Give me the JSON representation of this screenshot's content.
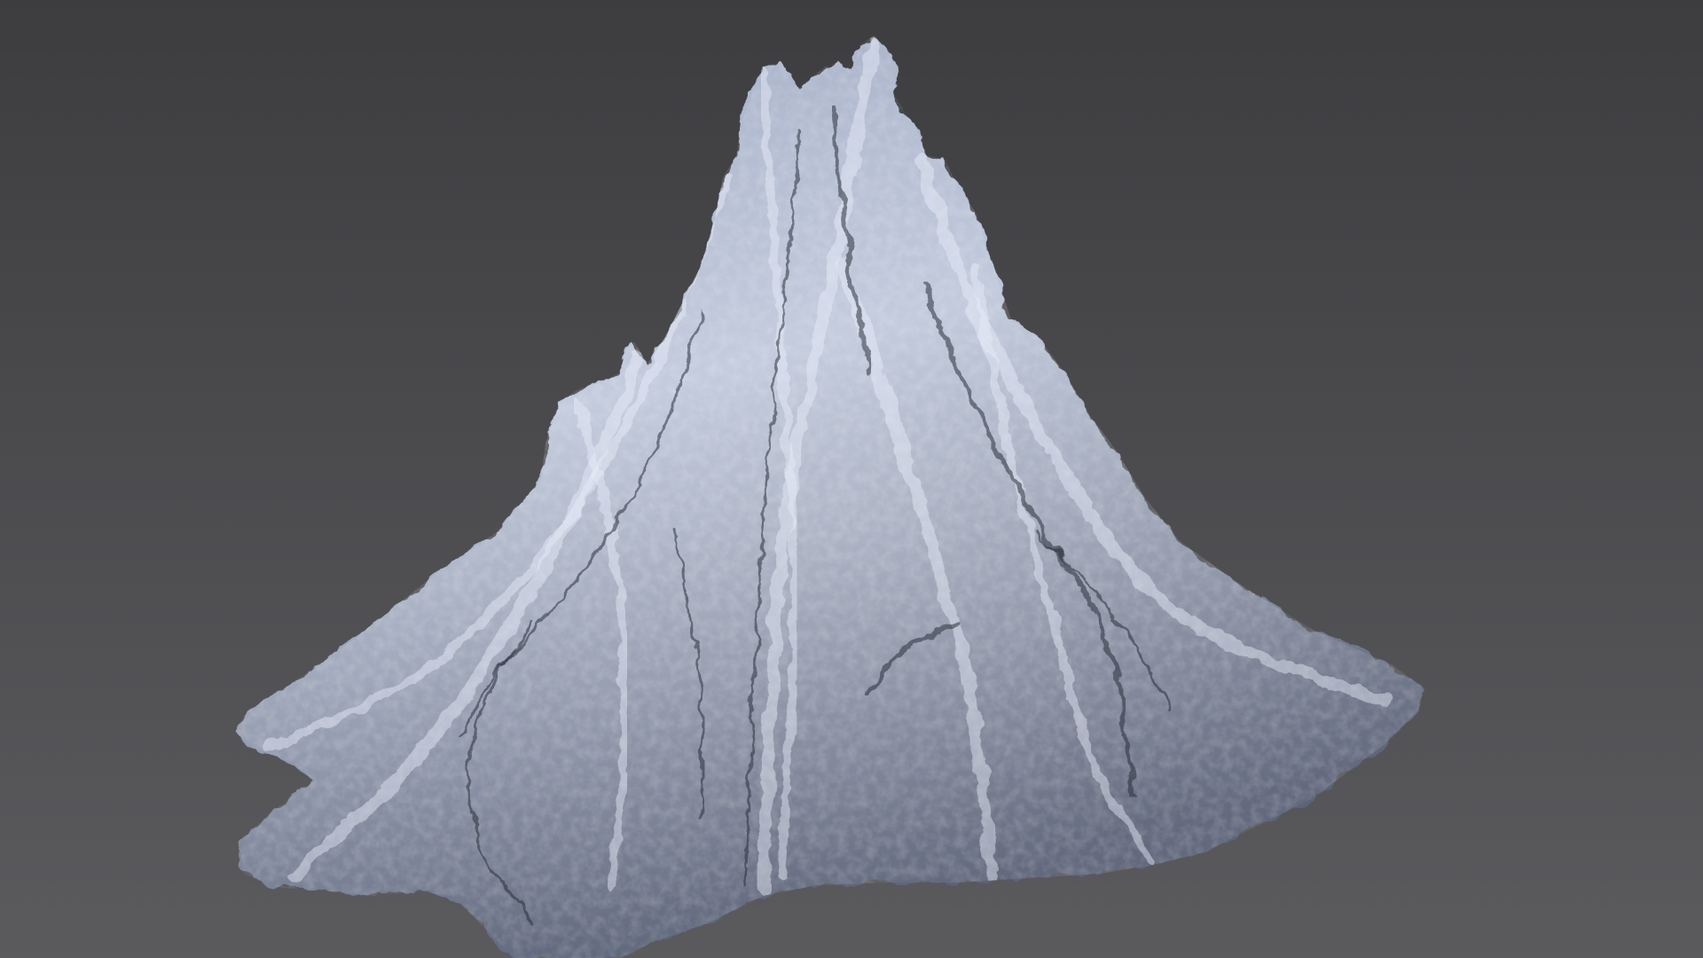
{
  "viewport": {
    "colors": {
      "background_top": "#3d3d40",
      "background_bottom": "#5b5b5e",
      "model_highlight": "#e8eefa",
      "model_base": "#a3adc4",
      "model_shadow": "#5d6478",
      "model_crevice": "#2b2f3a"
    },
    "model": {
      "icon": "sculpted-mountain-mesh",
      "material": "matcap-clay-blue"
    }
  }
}
